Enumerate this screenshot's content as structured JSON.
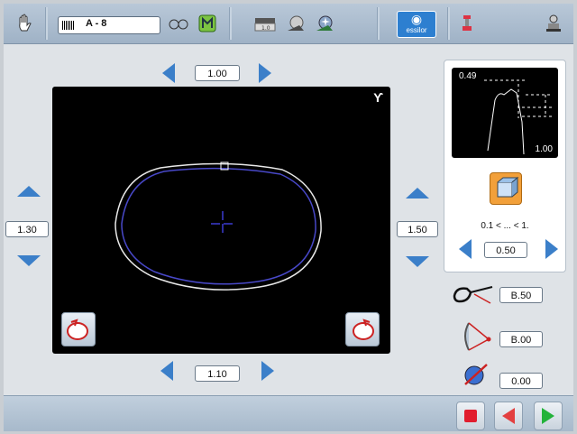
{
  "toolbar": {
    "job_label": "A - 8",
    "essilor_label": "essilor"
  },
  "lens": {
    "top_value": "1.00",
    "left_value": "1.30",
    "right_value": "1.50",
    "bottom_value": "1.10"
  },
  "preview": {
    "top_label": "0.49",
    "bottom_label": "1.00"
  },
  "right_panel": {
    "range_text": "0.1 < ... < 1.",
    "value": "0.50"
  },
  "measurements": {
    "frame_value": "B.50",
    "tilt_value": "B.00",
    "angle_value": "0.00"
  },
  "colors": {
    "accent": "#3b7fc9",
    "stop": "#e11d2e",
    "back": "#e34040",
    "forward": "#23b33a"
  }
}
